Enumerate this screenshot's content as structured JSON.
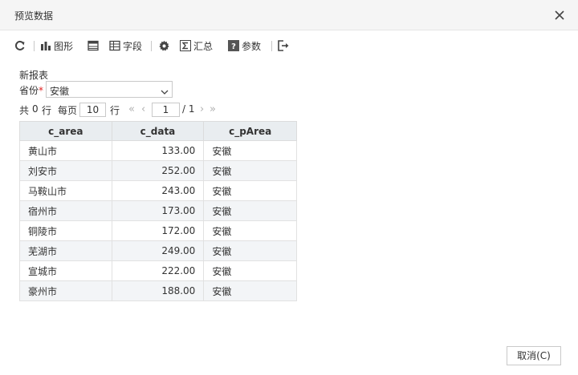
{
  "dialog": {
    "title": "预览数据",
    "close_icon": "close-icon"
  },
  "toolbar": {
    "refresh_icon": "refresh-icon",
    "chart_label": "图形",
    "chart_icon": "bar-chart-icon",
    "table_icon": "table-view-icon",
    "fields_label": "字段",
    "fields_icon": "fields-icon",
    "settings_icon": "gear-icon",
    "summary_label": "汇总",
    "summary_icon": "sigma-icon",
    "params_label": "参数",
    "params_icon": "help-icon",
    "export_icon": "export-icon"
  },
  "report": {
    "name": "新报表"
  },
  "param": {
    "label": "省份",
    "required_mark": "*",
    "value": "安徽"
  },
  "pager": {
    "total_prefix": "共",
    "total_count": "0",
    "total_suffix": "行",
    "per_page_label": "每页",
    "per_page_value": "10",
    "per_page_unit": "行",
    "first": "«",
    "prev": "‹",
    "current_page": "1",
    "page_total": "/ 1",
    "next": "›",
    "last": "»"
  },
  "table": {
    "columns": [
      "c_area",
      "c_data",
      "c_pArea"
    ],
    "rows": [
      [
        "黄山市",
        "133.00",
        "安徽"
      ],
      [
        "刘安市",
        "252.00",
        "安徽"
      ],
      [
        "马鞍山市",
        "243.00",
        "安徽"
      ],
      [
        "宿州市",
        "173.00",
        "安徽"
      ],
      [
        "铜陵市",
        "172.00",
        "安徽"
      ],
      [
        "芜湖市",
        "249.00",
        "安徽"
      ],
      [
        "宣城市",
        "222.00",
        "安徽"
      ],
      [
        "豪州市",
        "188.00",
        "安徽"
      ]
    ]
  },
  "footer": {
    "cancel_label": "取消(C)"
  },
  "colors": {
    "header_bg": "#e9edf0",
    "alt_row_bg": "#f3f5f7",
    "titlebar_bg": "#f5f5f5",
    "required": "#e02020"
  }
}
